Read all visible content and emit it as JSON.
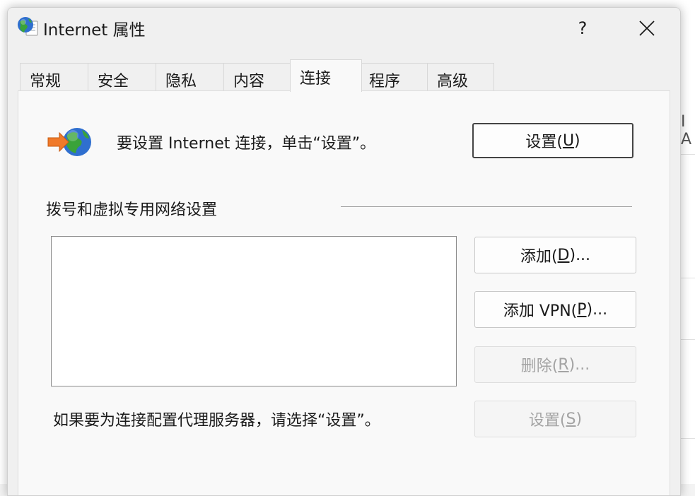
{
  "window": {
    "title": "Internet 属性",
    "help_label": "?"
  },
  "tabs": [
    {
      "label": "常规",
      "active": false
    },
    {
      "label": "安全",
      "active": false
    },
    {
      "label": "隐私",
      "active": false
    },
    {
      "label": "内容",
      "active": false
    },
    {
      "label": "连接",
      "active": true
    },
    {
      "label": "程序",
      "active": false
    },
    {
      "label": "高级",
      "active": false
    }
  ],
  "connections": {
    "intro_text": "要设置 Internet 连接，单击“设置”。",
    "setup_button": {
      "text": "设置(",
      "key": "U",
      "suffix": ")"
    },
    "dialup_section_label": "拨号和虚拟专用网络设置",
    "dialup_list_items": [],
    "add_button": {
      "text": "添加(",
      "key": "D",
      "suffix": ")..."
    },
    "add_vpn_button": {
      "text": "添加 VPN(",
      "key": "P",
      "suffix": ")..."
    },
    "remove_button": {
      "text": "删除(",
      "key": "R",
      "suffix": ")...",
      "disabled": true
    },
    "proxy_text": "如果要为连接配置代理服务器，请选择“设置”。",
    "settings_button": {
      "text": "设置(",
      "key": "S",
      "suffix": ")",
      "disabled": true
    }
  },
  "background": {
    "right_fragment": "I A"
  },
  "colors": {
    "window_bg": "#f0f0f0",
    "panel_bg": "#f9f9f9",
    "disabled_text": "#a3a3a3",
    "globe_blue": "#2f6fcf",
    "globe_green": "#3aa33a",
    "arrow_orange": "#f07a2a"
  },
  "icons": {
    "app": "internet-globe-icon",
    "connection": "connection-wizard-icon",
    "close": "close-icon"
  }
}
